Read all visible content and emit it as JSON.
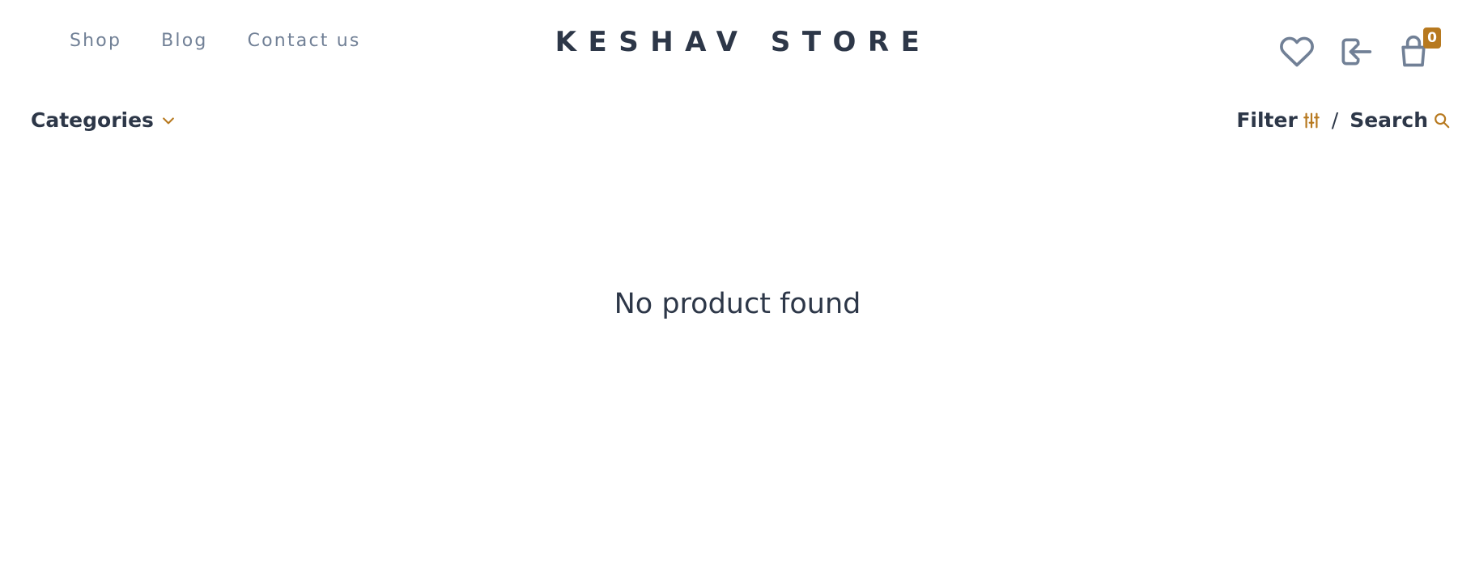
{
  "header": {
    "nav": [
      {
        "label": "Shop"
      },
      {
        "label": "Blog"
      },
      {
        "label": "Contact us"
      }
    ],
    "brand": "KESHAV STORE",
    "icons": {
      "wishlist": "heart-icon",
      "login": "login-icon",
      "cart": "shopping-bag-icon"
    },
    "cart_count": "0"
  },
  "toolbar": {
    "categories_label": "Categories",
    "filter_label": "Filter",
    "separator": "/",
    "search_label": "Search"
  },
  "main": {
    "empty_message": "No product found"
  },
  "colors": {
    "text_dark": "#2d3748",
    "text_muted": "#718096",
    "accent": "#b7791f",
    "background": "#ffffff"
  }
}
